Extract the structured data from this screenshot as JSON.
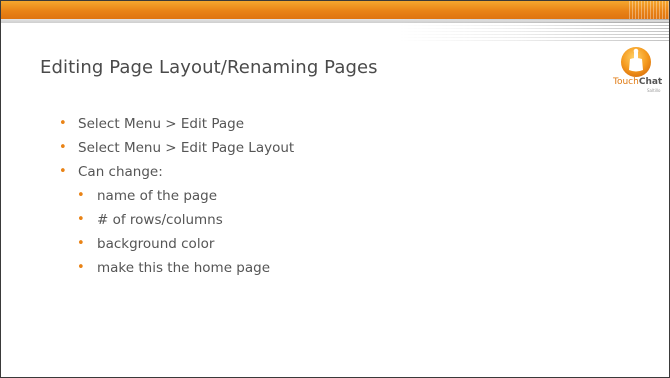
{
  "slide": {
    "title": "Editing Page Layout/Renaming Pages",
    "logo": {
      "icon": "touchchat-hand-icon",
      "brand_part1": "Touch",
      "brand_part2": "Chat",
      "tagline": "Saltillo"
    },
    "bullets": [
      {
        "text": "Select Menu > Edit Page",
        "level": 1
      },
      {
        "text": "Select Menu > Edit Page Layout",
        "level": 1
      },
      {
        "text": "Can change:",
        "level": 1
      },
      {
        "text": "name of the page",
        "level": 2
      },
      {
        "text": "# of rows/columns",
        "level": 2
      },
      {
        "text": "background color",
        "level": 2
      },
      {
        "text": "make this the home page",
        "level": 2
      }
    ],
    "bullet_glyph": "•",
    "colors": {
      "accent": "#e98316",
      "title_text": "#4a4a4a",
      "body_text": "#555555"
    }
  }
}
